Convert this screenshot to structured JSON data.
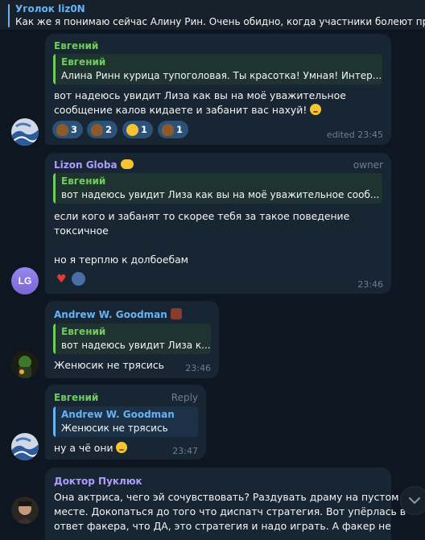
{
  "pinned": {
    "title": "Уголок liz0N",
    "text": "Как же я понимаю сейчас Алину Рин. Очень обидно, когда участники болеют про"
  },
  "messages": [
    {
      "sender": "Евгений",
      "reply": {
        "name": "Евгений",
        "text": "Алина Ринн курица тупоголовая. Ты красотка! Умная! Интер..."
      },
      "lines": [
        "вот надеюсь увидит Лиза как вы на моё уважительное",
        "сообщение калов кидаете и забанит вас нахуй!"
      ],
      "reactions": [
        {
          "icon": "poop-emoji",
          "count": "3"
        },
        {
          "icon": "poop-emoji",
          "count": "2"
        },
        {
          "icon": "grin-emoji",
          "count": "1"
        },
        {
          "icon": "poop-emoji",
          "count": "1"
        }
      ],
      "time": "edited 23:45"
    },
    {
      "sender": "Lizon Globa",
      "role": "owner",
      "avatar": "LG",
      "reply": {
        "name": "Евгений",
        "text": "вот надеюсь увидит Лиза как вы на моё уважительное сооб..."
      },
      "lines": [
        "если кого и забанят то скорее тебя за такое поведение",
        "токсичное",
        "но я терплю к долбоебам"
      ],
      "time": "23:46"
    },
    {
      "sender": "Andrew W. Goodman",
      "reply": {
        "name": "Евгений",
        "text": "вот надеюсь увидит Лиза к..."
      },
      "lines": [
        "Женюсик не трясись"
      ],
      "time": "23:46"
    },
    {
      "sender": "Евгений",
      "role": "Reply",
      "reply": {
        "name": "Andrew W. Goodman",
        "text": "Женюсик не трясись"
      },
      "lines": [
        "ну а чё они"
      ],
      "time": "23:47"
    },
    {
      "sender": "Доктор Пуклюк",
      "lines": [
        "Она актриса, чего эй сочувствовать? Раздувать драму на пустом",
        "месте. Докопаться до того что диспатч стратегия. Вот упёрлась в",
        "ответ факера, что ДА, это стратегия и надо играть. А факер не"
      ]
    }
  ],
  "colors": {
    "background": "#0e1621",
    "bubble": "#182533",
    "accent": "#6ab2f2",
    "green_name": "#6fcb5c",
    "purple_name": "#b09cff",
    "reaction": "#2b5278"
  }
}
